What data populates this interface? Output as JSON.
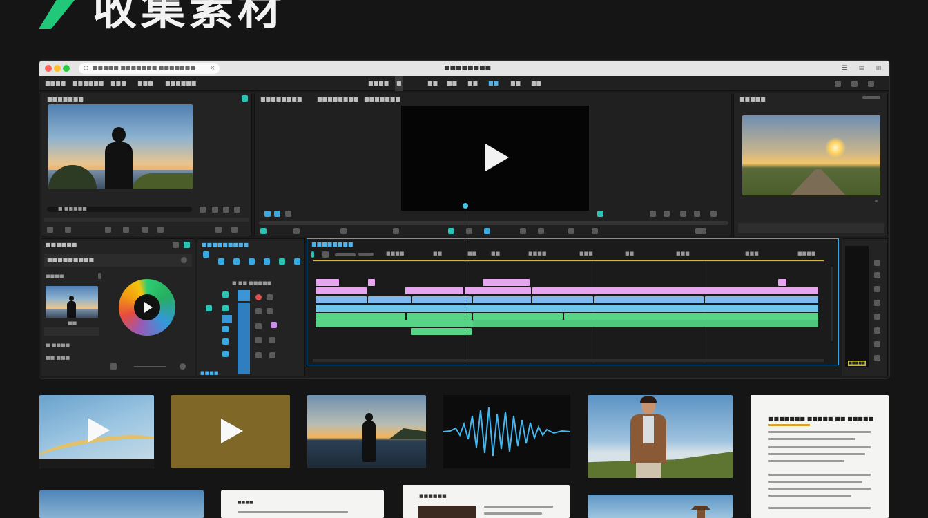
{
  "page": {
    "title": "收集素材",
    "accent": "#2bd37f"
  },
  "window": {
    "url": "■■■■■ ■■■■■■■ ■■■■■■■",
    "title": "■■■■■■■■",
    "menu": [
      "■■■■",
      "■■■■■■",
      "■■■",
      "■■■",
      "■■■■■■"
    ],
    "workspace_tabs": [
      "■■■■",
      "■",
      "■■",
      "■■",
      "■■",
      "■■",
      "■■",
      "■■"
    ]
  },
  "source_panel": {
    "tabs": [
      "■■■■■■■"
    ],
    "timecode": "■ ■■■■■"
  },
  "program_panel": {
    "tabs": [
      "■■■■■■■■",
      "■■■■■■■■",
      "■■■■■■■"
    ],
    "icon": "play-icon"
  },
  "preview_panel": {
    "title": "■■■■■"
  },
  "project_panel": {
    "title": "■■■■■■",
    "subtitle": "■■■■■■■■■",
    "clip_name": "■■■■",
    "items": [
      "■ ■■■■",
      "■■ ■■■"
    ]
  },
  "color_panel": {
    "wheel_colors": [
      "#f39c12",
      "#2ecc71",
      "#3498db",
      "#9b59b6",
      "#e74c3c"
    ]
  },
  "tools_panel": {
    "title": "■■■■■■■■■",
    "label": "■ ■■ ■■■■■",
    "footer": "■■■■"
  },
  "timeline": {
    "title": "■■■■■■■■",
    "ruler": [
      "■■■■",
      "■■",
      "■■",
      "■■",
      "■■■■",
      "■■■",
      "■■",
      "■■■",
      "■■■",
      "■■■■"
    ],
    "badge": "■■■■■"
  },
  "thumbnails": {
    "doc1_title": "■■■■■■■ ■■■■■ ■■ ■■■■■",
    "doc2_title": "■■■■",
    "doc3_title": "■■■■■■"
  }
}
